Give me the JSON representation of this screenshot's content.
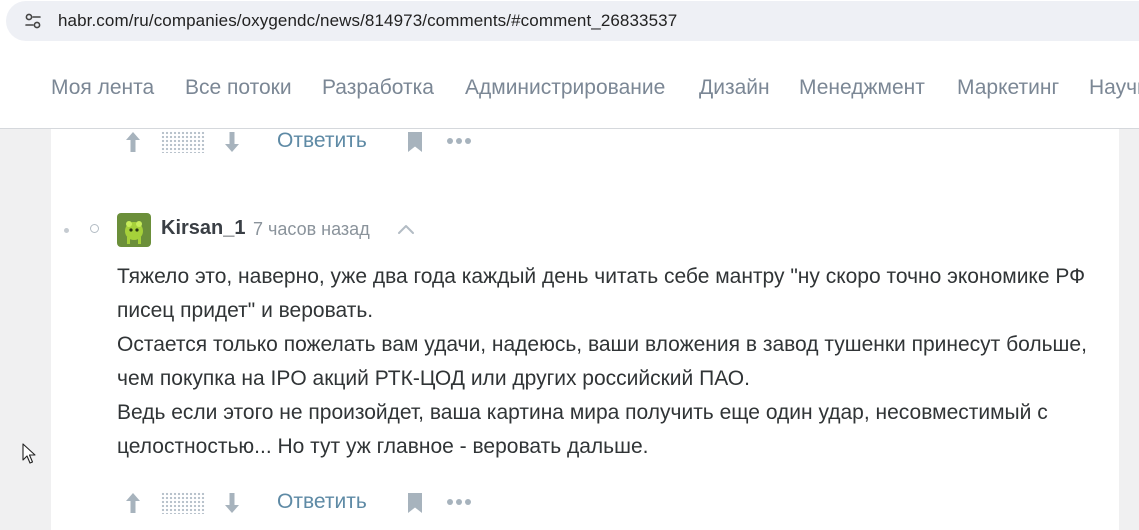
{
  "browser": {
    "url": "habr.com/ru/companies/oxygendc/news/814973/comments/#comment_26833537",
    "site_info_icon": "tune-icon"
  },
  "nav": {
    "items": [
      "Моя лента",
      "Все потоки",
      "Разработка",
      "Администрирование",
      "Дизайн",
      "Менеджмент",
      "Маркетинг",
      "Научпоп"
    ]
  },
  "prev_comment_actions": {
    "reply_label": "Ответить"
  },
  "comment": {
    "author": "Kirsan_1",
    "time": "7 часов назад",
    "lines": [
      "Тяжело это, наверно, уже два года каждый день читать себе мантру \"ну скоро точно экономике РФ писец придет\" и веровать.",
      "Остается только пожелать вам удачи, надеюсь, ваши вложения в завод тушенки принесут больше, чем покупка на IPO акций РТК-ЦОД или других российский ПАО.",
      "Ведь если этого не произойдет, ваша картина мира получить еще один удар, несовместимый с целостностью... Но тут уж главное - веровать дальше."
    ],
    "reply_label": "Ответить"
  },
  "colors": {
    "link": "#5e8aa5",
    "nav_text": "#7b8795",
    "body_text": "#303436",
    "page_bg": "#f0f0f1"
  }
}
